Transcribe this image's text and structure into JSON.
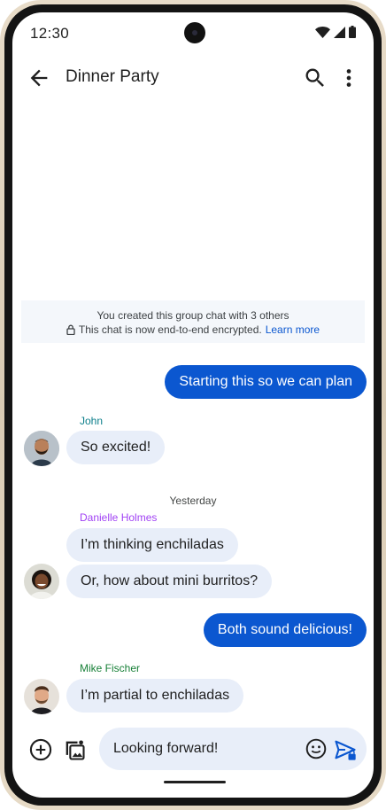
{
  "status_bar": {
    "time": "12:30"
  },
  "app_bar": {
    "title": "Dinner Party"
  },
  "system_message": {
    "line1": "You created this group chat with 3 others",
    "line2": "This chat is now end-to-end encrypted.",
    "learn_more": "Learn more"
  },
  "messages": [
    {
      "text": "Starting this so we can plan"
    },
    {
      "sender": "John",
      "text": "So excited!"
    },
    {
      "day_separator": "Yesterday"
    },
    {
      "sender": "Danielle Holmes",
      "text": "I’m thinking enchiladas"
    },
    {
      "text": "Or, how about mini burritos?"
    },
    {
      "text": "Both sound delicious!"
    },
    {
      "sender": "Mike Fischer",
      "text": "I’m partial to enchiladas"
    }
  ],
  "compose": {
    "value": "Looking forward!"
  },
  "colors": {
    "accent": "#0b57d0",
    "incoming_bubble": "#e8eef9",
    "sender_john": "#0b7e8a",
    "sender_danielle": "#a142f4",
    "sender_mike": "#188038"
  },
  "icons": [
    "back-arrow-icon",
    "search-icon",
    "more-vert-icon",
    "lock-icon",
    "add-circle-icon",
    "gallery-icon",
    "emoji-icon",
    "send-icon"
  ]
}
